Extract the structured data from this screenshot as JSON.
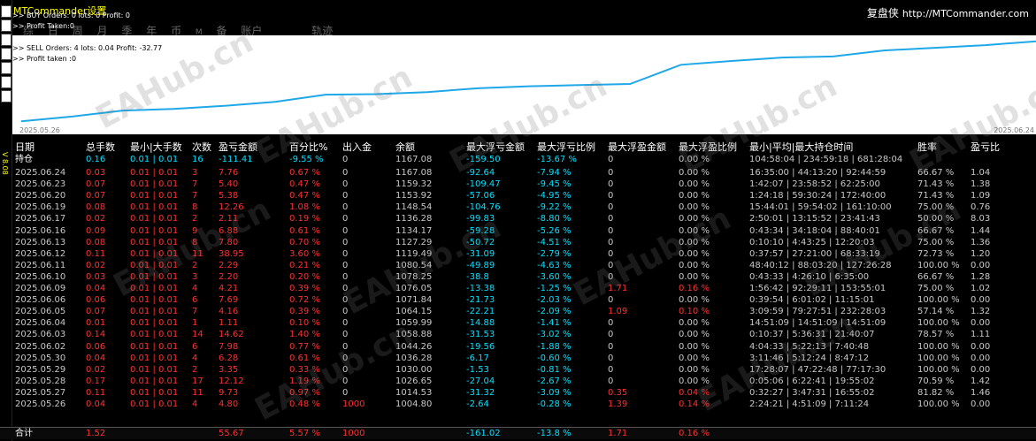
{
  "app_title": "MTCommander设置",
  "brand": {
    "name": "复盘侠",
    "url": "http://MTCommander.com"
  },
  "info": {
    "buy_line": "BUY  Orders: 0 lots: 0 Profit: 0",
    "buy_taken": "Profit Taken:0",
    "sell_line": "SELL Orders: 4 lots: 0.04 Profit: -32.77",
    "sell_taken": "Profit taken :0"
  },
  "tabs": [
    "综",
    "日",
    "周",
    "月",
    "季",
    "年",
    "币",
    "M",
    "备",
    "账户",
    "轨迹"
  ],
  "watermark": "EAHub.cn",
  "side_label": "V 8.08",
  "chart_data": {
    "type": "line",
    "x_start_label": "2025.05.26",
    "x_end_label": "2025.06.24",
    "x": [
      "2025.05.26",
      "2025.05.27",
      "2025.05.28",
      "2025.05.29",
      "2025.05.30",
      "2025.06.02",
      "2025.06.03",
      "2025.06.04",
      "2025.06.05",
      "2025.06.06",
      "2025.06.09",
      "2025.06.10",
      "2025.06.11",
      "2025.06.12",
      "2025.06.13",
      "2025.06.16",
      "2025.06.17",
      "2025.06.19",
      "2025.06.20",
      "2025.06.23",
      "2025.06.24"
    ],
    "values": [
      1004.8,
      1014.53,
      1026.65,
      1030.0,
      1036.28,
      1044.26,
      1058.88,
      1059.99,
      1064.15,
      1071.84,
      1076.05,
      1078.25,
      1080.54,
      1119.49,
      1127.29,
      1134.17,
      1136.28,
      1148.54,
      1153.92,
      1159.32,
      1167.08
    ],
    "ylim": [
      1000,
      1172
    ],
    "line_color": "#1fa8e8"
  },
  "table": {
    "headers": [
      "日期",
      "总手数",
      "最小|大手数",
      "次数",
      "盈亏金额",
      "百分比%",
      "出入金",
      "余额",
      "最大浮亏金额",
      "最大浮亏比例",
      "最大浮盈金额",
      "最大浮盈比例",
      "最小|平均|最大持仓时间",
      "胜率",
      "盈亏比"
    ],
    "holding": [
      "持仓",
      "0.16",
      "0.01 | 0.01",
      "16",
      "-111.41",
      "-9.55 %",
      "0",
      "1167.08",
      "-159.50",
      "-13.67 %",
      "0",
      "0.00 %",
      "104:58:04 | 234:59:18 | 681:28:04",
      "",
      ""
    ],
    "rows": [
      [
        "2025.06.24",
        "0.03",
        "0.01 | 0.01",
        "3",
        "7.76",
        "0.67 %",
        "0",
        "1167.08",
        "-92.64",
        "-7.94 %",
        "0",
        "0.00 %",
        "16:35:00 | 44:13:20 | 92:44:59",
        "66.67 %",
        "1.04"
      ],
      [
        "2025.06.23",
        "0.07",
        "0.01 | 0.01",
        "7",
        "5.40",
        "0.47 %",
        "0",
        "1159.32",
        "-109.47",
        "-9.45 %",
        "0",
        "0.00 %",
        "1:42:07 | 23:58:52 | 62:25:00",
        "71.43 %",
        "1.38"
      ],
      [
        "2025.06.20",
        "0.07",
        "0.01 | 0.01",
        "7",
        "5.38",
        "0.47 %",
        "0",
        "1153.92",
        "-57.06",
        "-4.95 %",
        "0",
        "0.00 %",
        "1:24:18 | 59:30:24 | 172:40:00",
        "71.43 %",
        "1.09"
      ],
      [
        "2025.06.19",
        "0.08",
        "0.01 | 0.01",
        "8",
        "12.26",
        "1.08 %",
        "0",
        "1148.54",
        "-104.76",
        "-9.22 %",
        "0",
        "0.00 %",
        "15:44:01 | 59:54:02 | 161:10:00",
        "75.00 %",
        "0.76"
      ],
      [
        "2025.06.17",
        "0.02",
        "0.01 | 0.01",
        "2",
        "2.11",
        "0.19 %",
        "0",
        "1136.28",
        "-99.83",
        "-8.80 %",
        "0",
        "0.00 %",
        "2:50:01 | 13:15:52 | 23:41:43",
        "50.00 %",
        "8.03"
      ],
      [
        "2025.06.16",
        "0.09",
        "0.01 | 0.01",
        "9",
        "6.88",
        "0.61 %",
        "0",
        "1134.17",
        "-59.28",
        "-5.26 %",
        "0",
        "0.00 %",
        "0:43:34 | 34:18:04 | 88:40:01",
        "66.67 %",
        "1.44"
      ],
      [
        "2025.06.13",
        "0.08",
        "0.01 | 0.01",
        "8",
        "7.80",
        "0.70 %",
        "0",
        "1127.29",
        "-50.72",
        "-4.51 %",
        "0",
        "0.00 %",
        "0:10:10 | 4:43:25 | 12:20:03",
        "75.00 %",
        "1.36"
      ],
      [
        "2025.06.12",
        "0.11",
        "0.01 | 0.01",
        "11",
        "38.95",
        "3.60 %",
        "0",
        "1119.49",
        "-31.09",
        "-2.79 %",
        "0",
        "0.00 %",
        "0:37:57 | 27:21:00 | 68:33:19",
        "72.73 %",
        "1.20"
      ],
      [
        "2025.06.11",
        "0.02",
        "0.01 | 0.01",
        "2",
        "2.29",
        "0.21 %",
        "0",
        "1080.54",
        "-49.89",
        "-4.63 %",
        "0",
        "0.00 %",
        "48:40:12 | 88:03:20 | 127:26:28",
        "100.00 %",
        "0.00"
      ],
      [
        "2025.06.10",
        "0.03",
        "0.01 | 0.01",
        "3",
        "2.20",
        "0.20 %",
        "0",
        "1078.25",
        "-38.8",
        "-3.60 %",
        "0",
        "0.00 %",
        "0:43:33 | 4:26:10 | 6:35:00",
        "66.67 %",
        "1.28"
      ],
      [
        "2025.06.09",
        "0.04",
        "0.01 | 0.01",
        "4",
        "4.21",
        "0.39 %",
        "0",
        "1076.05",
        "-13.38",
        "-1.25 %",
        "1.71",
        "0.16 %",
        "1:56:42 | 92:29:11 | 153:55:01",
        "75.00 %",
        "1.02"
      ],
      [
        "2025.06.06",
        "0.06",
        "0.01 | 0.01",
        "6",
        "7.69",
        "0.72 %",
        "0",
        "1071.84",
        "-21.73",
        "-2.03 %",
        "0",
        "0.00 %",
        "0:39:54 | 6:01:02 | 11:15:01",
        "100.00 %",
        "0.00"
      ],
      [
        "2025.06.05",
        "0.07",
        "0.01 | 0.01",
        "7",
        "4.16",
        "0.39 %",
        "0",
        "1064.15",
        "-22.21",
        "-2.09 %",
        "1.09",
        "0.10 %",
        "3:09:59 | 79:27:51 | 232:28:03",
        "57.14 %",
        "1.32"
      ],
      [
        "2025.06.04",
        "0.01",
        "0.01 | 0.01",
        "1",
        "1.11",
        "0.10 %",
        "0",
        "1059.99",
        "-14.88",
        "-1.41 %",
        "0",
        "0.00 %",
        "14:51:09 | 14:51:09 | 14:51:09",
        "100.00 %",
        "0.00"
      ],
      [
        "2025.06.03",
        "0.14",
        "0.01 | 0.01",
        "14",
        "14.62",
        "1.40 %",
        "0",
        "1058.88",
        "-31.53",
        "-3.02 %",
        "0",
        "0.00 %",
        "0:10:37 | 5:36:31 | 21:40:07",
        "78.57 %",
        "1.11"
      ],
      [
        "2025.06.02",
        "0.06",
        "0.01 | 0.01",
        "6",
        "7.98",
        "0.77 %",
        "0",
        "1044.26",
        "-19.56",
        "-1.88 %",
        "0",
        "0.00 %",
        "4:04:33 | 5:22:13 | 7:40:48",
        "100.00 %",
        "0.00"
      ],
      [
        "2025.05.30",
        "0.04",
        "0.01 | 0.01",
        "4",
        "6.28",
        "0.61 %",
        "0",
        "1036.28",
        "-6.17",
        "-0.60 %",
        "0",
        "0.00 %",
        "3:11:46 | 5:12:24 | 8:47:12",
        "100.00 %",
        "0.00"
      ],
      [
        "2025.05.29",
        "0.02",
        "0.01 | 0.01",
        "2",
        "3.35",
        "0.33 %",
        "0",
        "1030.00",
        "-1.53",
        "-0.81 %",
        "0",
        "0.00 %",
        "17:28:07 | 47:22:48 | 77:17:30",
        "100.00 %",
        "0.00"
      ],
      [
        "2025.05.28",
        "0.17",
        "0.01 | 0.01",
        "17",
        "12.12",
        "1.19 %",
        "0",
        "1026.65",
        "-27.04",
        "-2.67 %",
        "0",
        "0.00 %",
        "0:05:06 | 6:22:41 | 19:55:02",
        "70.59 %",
        "1.42"
      ],
      [
        "2025.05.27",
        "0.11",
        "0.01 | 0.01",
        "11",
        "9.73",
        "0.97 %",
        "0",
        "1014.53",
        "-31.32",
        "-3.09 %",
        "0.35",
        "0.04 %",
        "0:32:27 | 3:47:31 | 16:55:02",
        "81.82 %",
        "1.46"
      ],
      [
        "2025.05.26",
        "0.04",
        "0.01 | 0.01",
        "4",
        "4.80",
        "0.48 %",
        "1000",
        "1004.80",
        "-2.64",
        "-0.28 %",
        "1.39",
        "0.14 %",
        "2:24:21 | 4:51:09 | 7:11:24",
        "100.00 %",
        "0.00"
      ]
    ],
    "total": [
      "合计",
      "1.52",
      "",
      "",
      "55.67",
      "5.57 %",
      "1000",
      "",
      "-161.02",
      "-13.8 %",
      "1.71",
      "0.16 %",
      "",
      "",
      ""
    ]
  },
  "colors": {
    "profit": "#ff3030",
    "float_loss": "#00e0ff",
    "neutral": "#c8c8c8",
    "header": "#ffffff"
  }
}
